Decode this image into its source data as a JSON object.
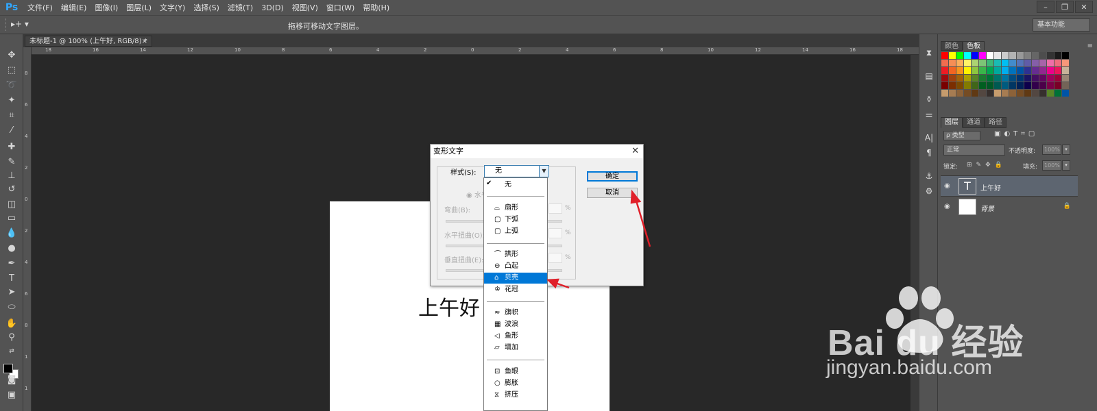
{
  "app": {
    "logo": "Ps"
  },
  "menu": [
    "文件(F)",
    "编辑(E)",
    "图像(I)",
    "图层(L)",
    "文字(Y)",
    "选择(S)",
    "滤镜(T)",
    "3D(D)",
    "视图(V)",
    "窗口(W)",
    "帮助(H)"
  ],
  "window_controls": [
    "–",
    "❐",
    "✕"
  ],
  "options_bar": {
    "tool_icon": "move-tool-icon",
    "hint": "拖移可移动文字图层。",
    "workspace": "基本功能"
  },
  "document_tab": {
    "title": "未标题-1 @ 100% (上午好, RGB/8) *",
    "close": "×"
  },
  "ruler_h_labels": [
    "18",
    "16",
    "14",
    "12",
    "10",
    "8",
    "6",
    "4",
    "2",
    "0",
    "2",
    "4",
    "6",
    "8",
    "10",
    "12",
    "14",
    "16",
    "18",
    "20"
  ],
  "ruler_v_labels": [
    "8",
    "6",
    "4",
    "2",
    "0",
    "2",
    "4",
    "6",
    "8",
    "1",
    "1",
    "1"
  ],
  "canvas": {
    "text": "上午好"
  },
  "swatches_panel": {
    "tabs": [
      "颜色",
      "色板"
    ],
    "active_tab": "色板"
  },
  "layers_panel": {
    "tabs": [
      "图层",
      "通道",
      "路径"
    ],
    "filter": "ρ 类型",
    "blend_mode": "正常",
    "opacity_label": "不透明度:",
    "opacity_value": "100%",
    "lock_label": "锁定:",
    "fill_label": "填充:",
    "fill_value": "100%",
    "layers": [
      {
        "name": "上午好",
        "thumb": "T",
        "selected": true
      },
      {
        "name": "背景",
        "thumb": "",
        "selected": false
      }
    ]
  },
  "dialog": {
    "title": "变形文字",
    "style_label": "样式(S):",
    "style_value": "无",
    "horizontal_label": "◉ 水平",
    "bend_label": "弯曲(B):",
    "h_distort_label": "水平扭曲(O):",
    "v_distort_label": "垂直扭曲(E):",
    "percent": "%",
    "ok": "确定",
    "cancel": "取消"
  },
  "style_options": [
    {
      "label": "无",
      "icon": "",
      "checked": true
    },
    {
      "label": "扇形",
      "icon": "⌓"
    },
    {
      "label": "下弧",
      "icon": "▢"
    },
    {
      "label": "上弧",
      "icon": "▢"
    },
    {
      "label": "拱形",
      "icon": "⌒"
    },
    {
      "label": "凸起",
      "icon": "⊖"
    },
    {
      "label": "贝壳",
      "icon": "⌂",
      "highlighted": true
    },
    {
      "label": "花冠",
      "icon": "♔"
    },
    {
      "label": "旗帜",
      "icon": "≈"
    },
    {
      "label": "波浪",
      "icon": "▦"
    },
    {
      "label": "鱼形",
      "icon": "◁"
    },
    {
      "label": "增加",
      "icon": "▱"
    },
    {
      "label": "鱼眼",
      "icon": "⊡"
    },
    {
      "label": "膨胀",
      "icon": "○"
    },
    {
      "label": "挤压",
      "icon": "⧖"
    }
  ],
  "watermark": {
    "brand": "Bai du 经验",
    "url": "jingyan.baidu.com"
  },
  "colors": {
    "accent": "#0078d7",
    "annotation": "#e0202a",
    "ps_blue": "#31a8ff"
  }
}
